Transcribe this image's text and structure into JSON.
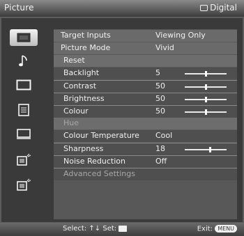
{
  "header": {
    "title": "Picture",
    "source": "Digital"
  },
  "sidebar": {
    "items": [
      {
        "icon": "picture-icon",
        "active": true
      },
      {
        "icon": "music-note-icon",
        "active": false
      },
      {
        "icon": "screen-icon",
        "active": false
      },
      {
        "icon": "list-icon",
        "active": false
      },
      {
        "icon": "display-icon",
        "active": false
      },
      {
        "icon": "input-icon",
        "active": false
      },
      {
        "icon": "tv-icon",
        "active": false
      },
      {
        "icon": "digital-icon",
        "active": false
      }
    ]
  },
  "menu": {
    "target_inputs": {
      "label": "Target Inputs",
      "value": "Viewing Only"
    },
    "picture_mode": {
      "label": "Picture Mode",
      "value": "Vivid"
    },
    "reset": {
      "label": "Reset"
    },
    "backlight": {
      "label": "Backlight",
      "value": "5",
      "level": 0.5
    },
    "contrast": {
      "label": "Contrast",
      "value": "50",
      "level": 0.5
    },
    "brightness": {
      "label": "Brightness",
      "value": "50",
      "level": 0.5
    },
    "colour": {
      "label": "Colour",
      "value": "50",
      "level": 0.5
    },
    "hue": {
      "label": "Hue"
    },
    "colour_temperature": {
      "label": "Colour Temperature",
      "value": "Cool"
    },
    "sharpness": {
      "label": "Sharpness",
      "value": "18",
      "level": 0.6
    },
    "noise_reduction": {
      "label": "Noise Reduction",
      "value": "Off"
    },
    "advanced_settings": {
      "label": "Advanced Settings"
    }
  },
  "footer": {
    "select_label": "Select:",
    "set_label": "Set:",
    "exit_label": "Exit:",
    "menu_key": "MENU"
  },
  "colors": {
    "background": "#5c5c5c",
    "panel": "#585858",
    "text": "#f0f0f0",
    "disabled_text": "#a8a8a8"
  }
}
